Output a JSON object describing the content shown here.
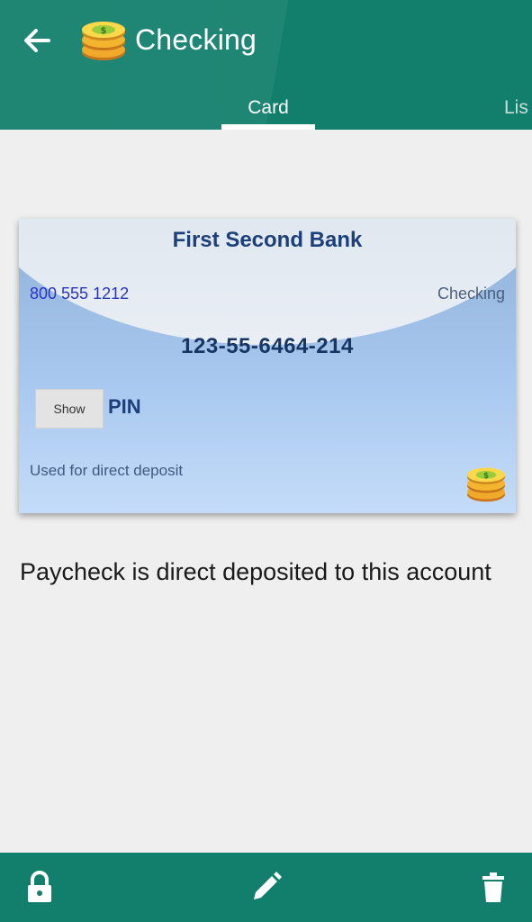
{
  "colors": {
    "primary": "#117f6c",
    "card_gradient_top": "#8fb0d8",
    "card_gradient_bottom": "#c4dcf8",
    "bank_text": "#1d3f7a",
    "phone_text": "#2b33c4"
  },
  "appbar": {
    "back_icon": "arrow-left-icon",
    "logo_icon": "coin-stack-icon",
    "title": "Checking"
  },
  "tabs": {
    "card": "Card",
    "list": "Lis",
    "selected": "Card"
  },
  "card": {
    "bank_name": "First Second Bank",
    "phone": "800 555 1212",
    "account_type": "Checking",
    "account_number": "123-55-6464-214",
    "show_button": "Show",
    "pin_label": "PIN",
    "note": "Used for direct deposit",
    "logo_icon": "coin-stack-icon"
  },
  "description": "Paycheck is direct deposited to this account",
  "bottom_bar": {
    "lock_icon": "lock-icon",
    "edit_icon": "pencil-icon",
    "delete_icon": "trash-icon"
  }
}
